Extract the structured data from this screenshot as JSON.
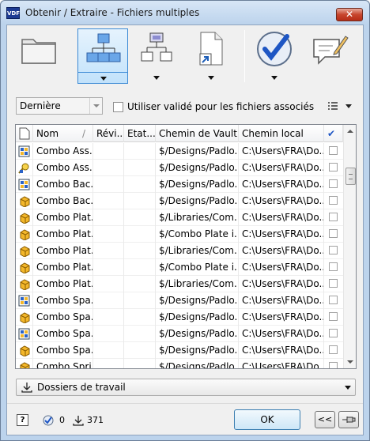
{
  "window": {
    "title": "Obtenir / Extraire - Fichiers multiples",
    "app_badge": "VDF",
    "close_label": "✕"
  },
  "toolbar": {
    "tools": [
      {
        "name": "folder-tool",
        "icon": "folder-icon",
        "has_dropdown": false,
        "selected": false
      },
      {
        "name": "parent-hierarchy-tool",
        "icon": "hierarchy-parents-icon",
        "has_dropdown": true,
        "selected": true
      },
      {
        "name": "child-hierarchy-tool",
        "icon": "hierarchy-children-icon",
        "has_dropdown": true,
        "selected": false
      },
      {
        "name": "shortcut-tool",
        "icon": "document-shortcut-icon",
        "has_dropdown": true,
        "selected": false
      },
      {
        "name": "checkout-tool",
        "icon": "checkmark-circle-icon",
        "has_dropdown": true,
        "selected": false
      },
      {
        "name": "comment-tool",
        "icon": "comment-pencil-icon",
        "has_dropdown": false,
        "selected": false
      }
    ]
  },
  "options": {
    "version_value": "Dernière",
    "use_released_label": "Utiliser validé pour les fichiers associés"
  },
  "grid": {
    "columns": [
      "Nom",
      "Révi...",
      "Etat...",
      "Chemin de Vault",
      "Chemin local",
      "✔"
    ],
    "sort_indicator": "/",
    "rows": [
      {
        "icon": "assembly-icon",
        "name": "Combo Ass...",
        "vault": "$/Designs/Padlo...",
        "local": "C:\\Users\\FRA\\Do..."
      },
      {
        "icon": "presentation-icon",
        "name": "Combo Ass...",
        "vault": "$/Designs/Padlo...",
        "local": "C:\\Users\\FRA\\Do..."
      },
      {
        "icon": "assembly-icon",
        "name": "Combo Bac...",
        "vault": "$/Designs/Padlo...",
        "local": "C:\\Users\\FRA\\Do..."
      },
      {
        "icon": "part-icon",
        "name": "Combo Bac...",
        "vault": "$/Designs/Padlo...",
        "local": "C:\\Users\\FRA\\Do..."
      },
      {
        "icon": "part-icon",
        "name": "Combo Plat...",
        "vault": "$/Libraries/Com...",
        "local": "C:\\Users\\FRA\\Do..."
      },
      {
        "icon": "part-icon",
        "name": "Combo Plat...",
        "vault": "$/Combo Plate i...",
        "local": "C:\\Users\\FRA\\Do..."
      },
      {
        "icon": "part-icon",
        "name": "Combo Plat...",
        "vault": "$/Libraries/Com...",
        "local": "C:\\Users\\FRA\\Do..."
      },
      {
        "icon": "part-icon",
        "name": "Combo Plat...",
        "vault": "$/Combo Plate i...",
        "local": "C:\\Users\\FRA\\Do..."
      },
      {
        "icon": "part-icon",
        "name": "Combo Plat...",
        "vault": "$/Libraries/Com...",
        "local": "C:\\Users\\FRA\\Do..."
      },
      {
        "icon": "assembly-icon",
        "name": "Combo Spa...",
        "vault": "$/Designs/Padlo...",
        "local": "C:\\Users\\FRA\\Do..."
      },
      {
        "icon": "part-icon",
        "name": "Combo Spa...",
        "vault": "$/Designs/Padlo...",
        "local": "C:\\Users\\FRA\\Do..."
      },
      {
        "icon": "assembly-icon",
        "name": "Combo Spa...",
        "vault": "$/Designs/Padlo...",
        "local": "C:\\Users\\FRA\\Do..."
      },
      {
        "icon": "part-icon",
        "name": "Combo Spa...",
        "vault": "$/Designs/Padlo...",
        "local": "C:\\Users\\FRA\\Do..."
      },
      {
        "icon": "part-icon",
        "name": "Combo Spri...",
        "vault": "$/Designs/Padlo...",
        "local": "C:\\Users\\FRA\\Do..."
      }
    ]
  },
  "location": {
    "label": "Dossiers de travail"
  },
  "footer": {
    "help_label": "?",
    "checked_count": "0",
    "download_count": "371",
    "ok_label": "OK",
    "collapse_label": "<<"
  },
  "colors": {
    "titlebar": "#bcd3ec",
    "selected_tool": "#c2e2fb",
    "checkmark_blue": "#1e56c4",
    "part_orange": "#f3b72a"
  }
}
